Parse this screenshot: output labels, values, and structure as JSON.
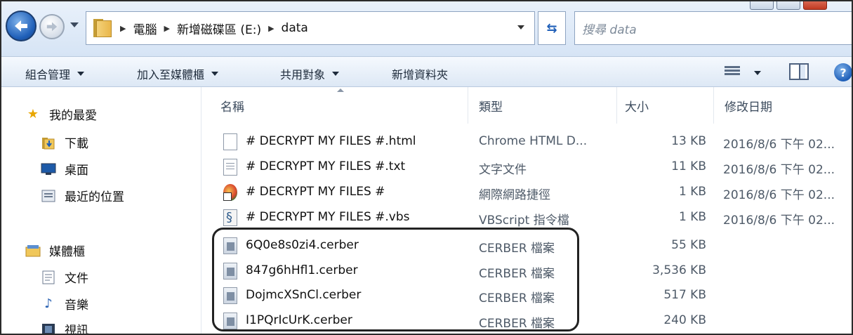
{
  "address_bar": {
    "crumbs": [
      "電腦",
      "新增磁碟區 (E:)",
      "data"
    ],
    "search_placeholder": "搜尋 data"
  },
  "toolbar": {
    "organize": "組合管理",
    "add_to_library": "加入至媒體櫃",
    "share_with": "共用對象",
    "new_folder": "新增資料夾"
  },
  "nav_pane": {
    "favorites": "我的最愛",
    "downloads": "下載",
    "desktop": "桌面",
    "recent": "最近的位置",
    "libraries": "媒體櫃",
    "documents": "文件",
    "music": "音樂",
    "videos": "視訊"
  },
  "columns": {
    "name": "名稱",
    "type": "類型",
    "size": "大小",
    "date": "修改日期"
  },
  "files": [
    {
      "name": "# DECRYPT MY FILES #.html",
      "type": "Chrome HTML D...",
      "size": "13 KB",
      "date": "2016/8/6 下午 02...",
      "icon": "html-file-icon"
    },
    {
      "name": "# DECRYPT MY FILES #.txt",
      "type": "文字文件",
      "size": "11 KB",
      "date": "2016/8/6 下午 02...",
      "icon": "text-file-icon"
    },
    {
      "name": "# DECRYPT MY FILES #",
      "type": "網際網路捷徑",
      "size": "1 KB",
      "date": "2016/8/6 下午 02...",
      "icon": "internet-shortcut-icon"
    },
    {
      "name": "# DECRYPT MY FILES #.vbs",
      "type": "VBScript 指令檔",
      "size": "1 KB",
      "date": "2016/8/6 下午 02...",
      "icon": "vbscript-file-icon"
    },
    {
      "name": "6Q0e8s0zi4.cerber",
      "type": "CERBER 檔案",
      "size": "55 KB",
      "date": "",
      "icon": "cerber-file-icon"
    },
    {
      "name": "847g6hHfl1.cerber",
      "type": "CERBER 檔案",
      "size": "3,536 KB",
      "date": "",
      "icon": "cerber-file-icon"
    },
    {
      "name": "DojmcXSnCl.cerber",
      "type": "CERBER 檔案",
      "size": "517 KB",
      "date": "",
      "icon": "cerber-file-icon"
    },
    {
      "name": "I1PQrIcUrK.cerber",
      "type": "CERBER 檔案",
      "size": "240 KB",
      "date": "",
      "icon": "cerber-file-icon"
    }
  ]
}
